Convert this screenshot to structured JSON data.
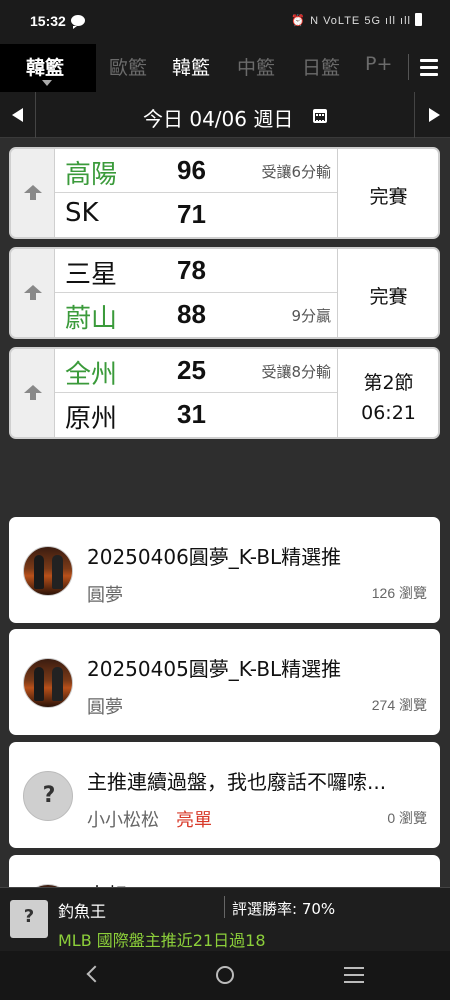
{
  "status_bar": {
    "time": "15:32",
    "icons": "⏰ N VoLTE 5G ıll ıll"
  },
  "tabs": {
    "primary": "韓籃",
    "items": [
      {
        "label": "歐籃",
        "selected": false
      },
      {
        "label": "韓籃",
        "selected": true
      },
      {
        "label": "中籃",
        "selected": false
      },
      {
        "label": "日籃",
        "selected": false
      },
      {
        "label": "P+",
        "selected": false
      }
    ]
  },
  "date_bar": {
    "label": "今日 04/06 週日"
  },
  "games": [
    {
      "home": {
        "name": "高陽",
        "score": "96",
        "note": "受讓6分輸",
        "color": "green"
      },
      "away": {
        "name": "SK",
        "score": "71",
        "note": "",
        "color": "black"
      },
      "status": [
        "完賽"
      ]
    },
    {
      "home": {
        "name": "三星",
        "score": "78",
        "note": "",
        "color": "black"
      },
      "away": {
        "name": "蔚山",
        "score": "88",
        "note": "9分贏",
        "color": "green"
      },
      "status": [
        "完賽"
      ]
    },
    {
      "home": {
        "name": "全州",
        "score": "25",
        "note": "受讓8分輸",
        "color": "green"
      },
      "away": {
        "name": "原州",
        "score": "31",
        "note": "",
        "color": "black"
      },
      "status": [
        "第2節",
        "06:21"
      ]
    }
  ],
  "posts": [
    {
      "title": "20250406圓夢_K-BL精選推",
      "author": "圓夢",
      "tag": "",
      "views": "126 瀏覽",
      "avatar": "photo"
    },
    {
      "title": "20250405圓夢_K-BL精選推",
      "author": "圓夢",
      "tag": "",
      "views": "274 瀏覽",
      "avatar": "photo"
    },
    {
      "title": "主推連續過盤，我也廢話不囉嗦...",
      "author": "小小松松",
      "tag": "亮單",
      "views": "0 瀏覽",
      "avatar": "default"
    },
    {
      "title": "大叔",
      "author": "",
      "tag": "",
      "views": "",
      "avatar": "photo"
    }
  ],
  "ad_bar": {
    "name": "釣魚王",
    "rate": "評選勝率: 70%",
    "text": "MLB 國際盤主推近21日過18"
  },
  "colors": {
    "green_team": "#3a9a3a",
    "tag_red": "#d83a2a",
    "ad_green": "#8ccf3a"
  },
  "icon_names": [
    "chat-icon",
    "menu-icon",
    "calendar-icon",
    "up-arrow-icon",
    "back-nav-icon",
    "home-nav-icon",
    "recent-apps-icon"
  ]
}
